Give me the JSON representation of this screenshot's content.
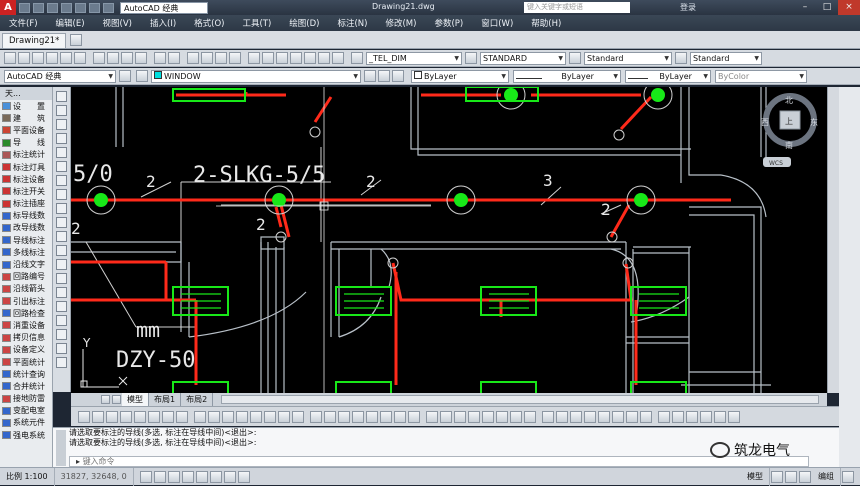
{
  "titlebar": {
    "workspace": "AutoCAD 经典",
    "document_title": "Drawing21.dwg",
    "search_placeholder": "键入关键字或短语",
    "login": "登录"
  },
  "menu": [
    "文件(F)",
    "编辑(E)",
    "视图(V)",
    "插入(I)",
    "格式(O)",
    "工具(T)",
    "绘图(D)",
    "标注(N)",
    "修改(M)",
    "参数(P)",
    "窗口(W)",
    "帮助(H)"
  ],
  "doc_tab": "Drawing21*",
  "styles": {
    "text_style": "_TEL_DIM",
    "dim_style": "STANDARD",
    "table_style": "Standard",
    "mleader_style": "Standard"
  },
  "workspace_combo": "AutoCAD 经典",
  "layer_combo": "WINDOW",
  "properties": {
    "color": "ByLayer",
    "linetype": "ByLayer",
    "lineweight": "ByLayer",
    "plotstyle": "ByColor"
  },
  "sidebar": {
    "header": "天...",
    "items": [
      "设　　置",
      "建　　筑",
      "平面设备",
      "导　　线",
      "标注统计",
      "标注灯具",
      "标注设备",
      "标注开关",
      "标注插座",
      "标导线数",
      "改导线数",
      "导线标注",
      "多线标注",
      "沿线文字",
      "回路编号",
      "沿线箭头",
      "引出标注",
      "回路检查",
      "消重设备",
      "拷贝信息",
      "设备定义",
      "平面统计",
      "统计查询",
      "合并统计",
      "接地防雷",
      "变配电室",
      "系统元件",
      "强电系统"
    ]
  },
  "canvas": {
    "labels": {
      "circuit": "2-SLKG-5/5",
      "circuit_partial": "5/0",
      "count_a": "2",
      "count_b": "2",
      "count_c": "3",
      "count_d": "2",
      "count_e": "2",
      "count_f": "2",
      "mm": "mm",
      "box": "DZY-50",
      "axis_y": "Y"
    },
    "viewcube": {
      "north": "北",
      "south": "南",
      "west": "西",
      "east": "东",
      "top": "上",
      "wcs": "WCS"
    }
  },
  "layout_tabs": [
    "模型",
    "布局1",
    "布局2"
  ],
  "command_history": [
    "请选取要标注的导线(多选, 标注在导线中间)<退出>:",
    "请选取要标注的导线(多选, 标注在导线中间)<退出>:"
  ],
  "command_placeholder": "键入命令",
  "status": {
    "scale": "比例 1:100",
    "coords": "31827, 32648, 0",
    "model": "模型",
    "mode": "编组"
  },
  "watermark": "筑龙电气",
  "colors": {
    "wire": "#ff2a1a",
    "fixture": "#18e818",
    "wall": "#b8c0c8",
    "text": "#e8e8e8"
  }
}
